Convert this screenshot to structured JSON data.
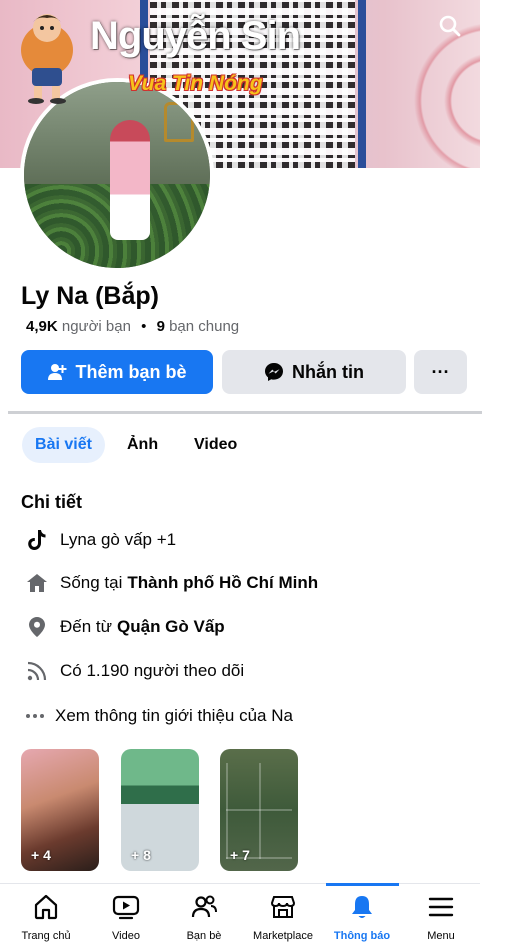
{
  "watermark": {
    "title": "Nguyễn Sin",
    "subtitle": "Vua Tin Nóng"
  },
  "profile": {
    "name": "Ly Na (Bắp)",
    "friends_count": "4,9K",
    "friends_label": "người bạn",
    "mutual_count": "9",
    "mutual_label": "bạn chung"
  },
  "actions": {
    "add_friend": "Thêm bạn bè",
    "message": "Nhắn tin",
    "more": "···"
  },
  "tabs": [
    {
      "label": "Bài viết",
      "active": true
    },
    {
      "label": "Ảnh",
      "active": false
    },
    {
      "label": "Video",
      "active": false
    }
  ],
  "details": {
    "title": "Chi tiết",
    "tiktok": "Lyna gò vấp +1",
    "lives_prefix": "Sống tại",
    "lives_place": "Thành phố Hồ Chí Minh",
    "from_prefix": "Đến từ",
    "from_place": "Quận Gò Vấp",
    "followers": "Có 1.190 người theo dõi",
    "see_more": "Xem thông tin giới thiệu của Na"
  },
  "photos": [
    {
      "count": "+ 4",
      "label": ""
    },
    {
      "count": "+ 8",
      "label": ""
    },
    {
      "count": "+ 7",
      "label": ""
    }
  ],
  "bottom_nav": [
    {
      "label": "Trang chủ",
      "icon": "home-icon",
      "active": false
    },
    {
      "label": "Video",
      "icon": "video-icon",
      "active": false
    },
    {
      "label": "Bạn bè",
      "icon": "friends-icon",
      "active": false
    },
    {
      "label": "Marketplace",
      "icon": "marketplace-icon",
      "active": false
    },
    {
      "label": "Thông báo",
      "icon": "bell-icon",
      "active": true
    },
    {
      "label": "Menu",
      "icon": "menu-icon",
      "active": false
    }
  ],
  "colors": {
    "primary": "#1877f2",
    "secondary_button": "#e4e6eb",
    "muted_text": "#65676b"
  }
}
